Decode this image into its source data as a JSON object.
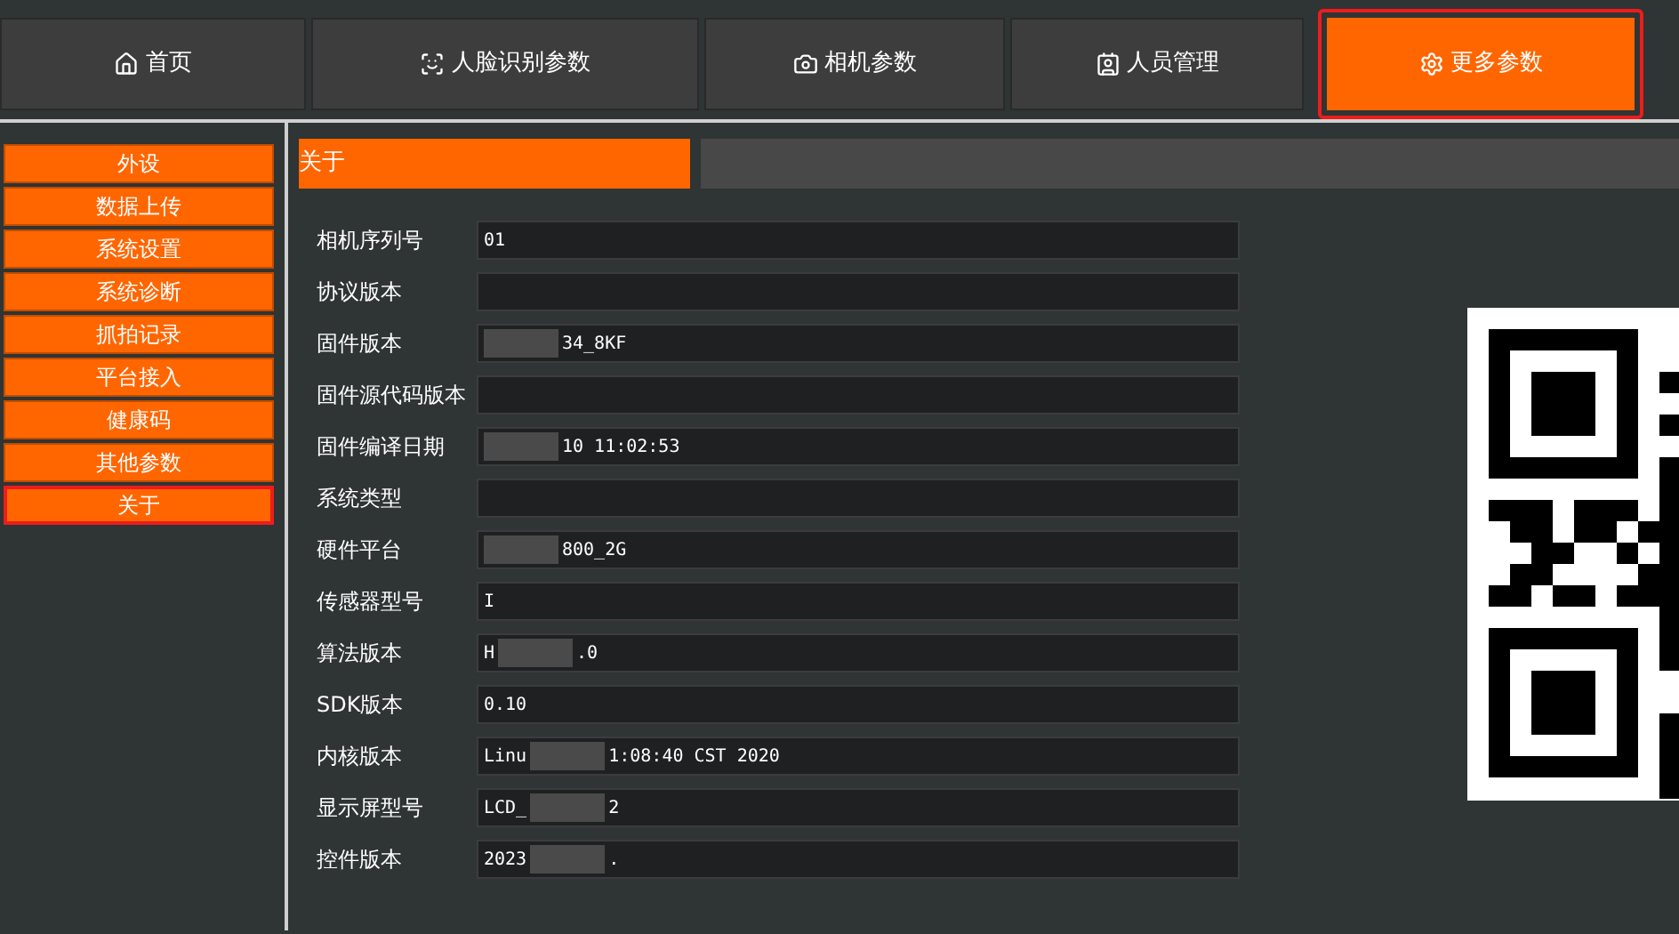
{
  "tabs": [
    {
      "label": "首页",
      "selected": false
    },
    {
      "label": "人脸识别参数",
      "selected": false
    },
    {
      "label": "相机参数",
      "selected": false
    },
    {
      "label": "人员管理",
      "selected": false
    },
    {
      "label": "更多参数",
      "selected": true
    }
  ],
  "sidebar": {
    "items": [
      {
        "label": "外设",
        "selected": false
      },
      {
        "label": "数据上传",
        "selected": false
      },
      {
        "label": "系统设置",
        "selected": false
      },
      {
        "label": "系统诊断",
        "selected": false
      },
      {
        "label": "抓拍记录",
        "selected": false
      },
      {
        "label": "平台接入",
        "selected": false
      },
      {
        "label": "健康码",
        "selected": false
      },
      {
        "label": "其他参数",
        "selected": false
      },
      {
        "label": "关于",
        "selected": true
      }
    ]
  },
  "section_title": "关于",
  "fields": [
    {
      "label": "相机序列号",
      "value_parts": [
        "01"
      ]
    },
    {
      "label": "协议版本"
    },
    {
      "label": "固件版本",
      "masked_start": true,
      "value_parts": [
        "34_8KF"
      ]
    },
    {
      "label": "固件源代码版本"
    },
    {
      "label": "固件编译日期",
      "masked_start": true,
      "value_parts": [
        "10 11:02:53"
      ]
    },
    {
      "label": "系统类型"
    },
    {
      "label": "硬件平台",
      "masked_start": true,
      "value_parts": [
        "800_2G"
      ]
    },
    {
      "label": "传感器型号",
      "value_parts": [
        "I"
      ]
    },
    {
      "label": "算法版本",
      "value_parts": [
        "H",
        ".0"
      ]
    },
    {
      "label": "SDK版本",
      "value_parts": [
        "0.10"
      ]
    },
    {
      "label": "内核版本",
      "value_parts": [
        "Linu",
        "1:08:40 CST 2020"
      ]
    },
    {
      "label": "显示屏型号",
      "value_parts": [
        "LCD_",
        "2"
      ]
    },
    {
      "label": "控件版本",
      "value_parts": [
        "2023",
        "."
      ]
    }
  ]
}
